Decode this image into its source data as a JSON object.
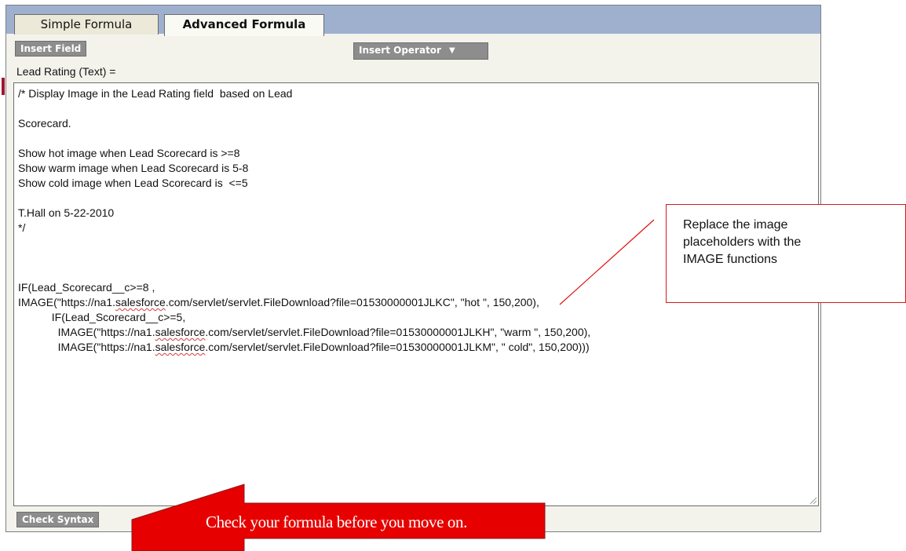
{
  "tabs": {
    "simple_label": "Simple Formula",
    "advanced_label": "Advanced Formula"
  },
  "toolbar": {
    "insert_field_label": "Insert Field",
    "insert_operator_label": "Insert Operator"
  },
  "field_label": "Lead Rating (Text) =",
  "editor_lines": [
    "/* Display Image in the Lead Rating field  based on Lead",
    "",
    "Scorecard.",
    "",
    "Show hot image when Lead Scorecard is >=8",
    "Show warm image when Lead Scorecard is 5-8",
    "Show cold image when Lead Scorecard is  <=5",
    "",
    "T.Hall on 5-22-2010",
    "*/",
    "",
    "",
    "",
    "IF(Lead_Scorecard__c>=8 ,",
    "IMAGE(\"https://na1.salesforce.com/servlet/servlet.FileDownload?file=01530000001JLKC\", \"hot \", 150,200),",
    "           IF(Lead_Scorecard__c>=5,",
    "             IMAGE(\"https://na1.salesforce.com/servlet/servlet.FileDownload?file=01530000001JLKH\", \"warm \", 150,200),",
    "             IMAGE(\"https://na1.salesforce.com/servlet/servlet.FileDownload?file=01530000001JLKM\", \" cold\", 150,200)))"
  ],
  "check_syntax_label": "Check Syntax",
  "callout": {
    "line1": "Replace the image",
    "line2": "placeholders with the",
    "line3": "IMAGE functions"
  },
  "arrow_label": "Check your formula before you move on.",
  "colors": {
    "tab_bar": "#9fb0cf",
    "callout_border": "#d01b1b",
    "arrow_fill": "#e60000",
    "button_grey": "#8d8d8d"
  }
}
